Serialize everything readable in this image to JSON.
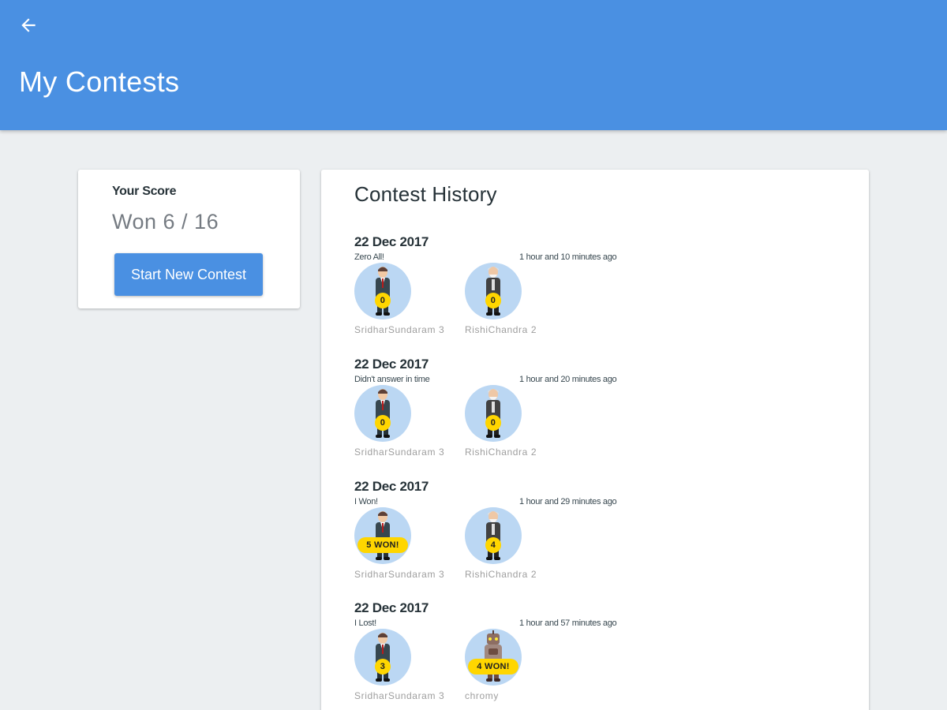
{
  "header": {
    "title": "My Contests",
    "back_icon": "arrow-left-icon",
    "color": "#4A90E2"
  },
  "score": {
    "heading": "Your Score",
    "value": "Won 6 / 16",
    "button_label": "Start New Contest"
  },
  "history": {
    "title": "Contest History",
    "entries": [
      {
        "date": "22 Dec 2017",
        "note": "Zero All!",
        "time": "1 hour and 10 minutes ago",
        "players": [
          {
            "name": "SridharSundaram 3",
            "badge": "0",
            "avatar": "businessman-avatar"
          },
          {
            "name": "RishiChandra 2",
            "badge": "0",
            "avatar": "elder-avatar"
          }
        ]
      },
      {
        "date": "22 Dec 2017",
        "note": "Didn't answer in time",
        "time": "1 hour and 20 minutes ago",
        "players": [
          {
            "name": "SridharSundaram 3",
            "badge": "0",
            "avatar": "businessman-avatar"
          },
          {
            "name": "RishiChandra 2",
            "badge": "0",
            "avatar": "elder-avatar"
          }
        ]
      },
      {
        "date": "22 Dec 2017",
        "note": "I Won!",
        "time": "1 hour and 29 minutes ago",
        "players": [
          {
            "name": "SridharSundaram 3",
            "badge": "5 WON!",
            "avatar": "businessman-avatar"
          },
          {
            "name": "RishiChandra 2",
            "badge": "4",
            "avatar": "elder-avatar"
          }
        ]
      },
      {
        "date": "22 Dec 2017",
        "note": "I Lost!",
        "time": "1 hour and 57 minutes ago",
        "players": [
          {
            "name": "SridharSundaram 3",
            "badge": "3",
            "avatar": "businessman-avatar"
          },
          {
            "name": "chromy",
            "badge": "4 WON!",
            "avatar": "robot-avatar"
          }
        ]
      }
    ]
  },
  "colors": {
    "accent": "#4A90E2",
    "badge": "#FFD600",
    "avatar_bg": "#BBD7F3",
    "page_bg": "#ECEFF1"
  }
}
